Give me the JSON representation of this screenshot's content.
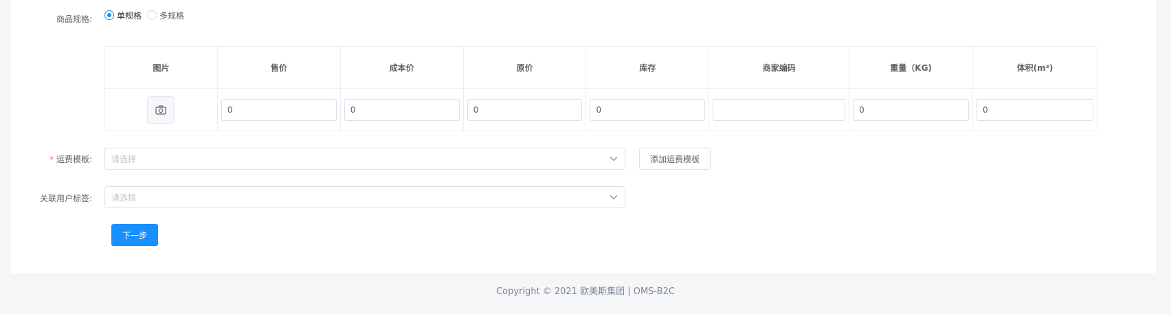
{
  "spec": {
    "label": "商品规格:",
    "options": [
      {
        "label": "单规格",
        "checked": true
      },
      {
        "label": "多规格",
        "checked": false
      }
    ]
  },
  "table": {
    "headers": [
      "图片",
      "售价",
      "成本价",
      "原价",
      "库存",
      "商家编码",
      "重量（KG)",
      "体积(m³)"
    ],
    "row": {
      "image_icon": "camera-icon",
      "price": "0",
      "cost_price": "0",
      "original_price": "0",
      "stock": "0",
      "merchant_code": "",
      "weight": "0",
      "volume": "0"
    }
  },
  "shipping": {
    "required_mark": "*",
    "label": "运费模板:",
    "placeholder": "请选择",
    "add_button": "添加运费模板"
  },
  "user_tag": {
    "label": "关联用户标签:",
    "placeholder": "请选择"
  },
  "next_button": "下一步",
  "footer": "Copyright © 2021 欧美斯集团 | OMS-B2C",
  "colors": {
    "primary": "#1890ff",
    "required": "#f56c6c",
    "page_bg": "#f5f6f8"
  }
}
